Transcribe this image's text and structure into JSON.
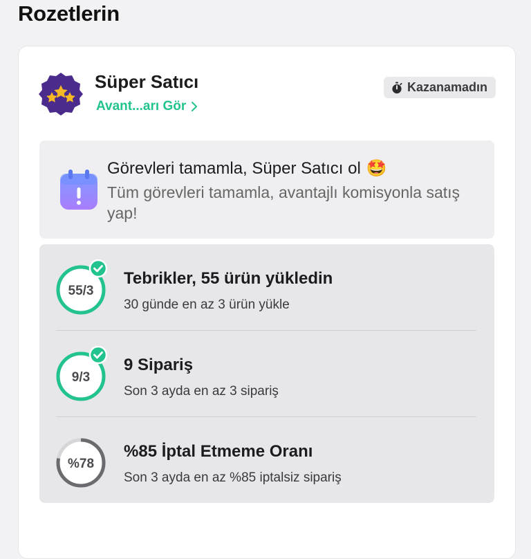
{
  "page_title": "Rozetlerin",
  "badge": {
    "name": "Süper Satıcı",
    "benefits_link": "Avant...arı Gör",
    "status": "Kazanamadın",
    "icon": "stars-badge-icon"
  },
  "info": {
    "title": "Görevleri tamamla, Süper Satıcı ol",
    "emoji": "🤩",
    "description": "Tüm görevleri tamamla, avantajlı komisyonla satış yap!",
    "icon": "calendar-alert-icon"
  },
  "tasks": [
    {
      "ring_label": "55/3",
      "progress": 1.0,
      "completed": true,
      "title": "Tebrikler, 55 ürün yükledin",
      "subtitle": "30 günde en az 3 ürün yükle"
    },
    {
      "ring_label": "9/3",
      "progress": 1.0,
      "completed": true,
      "title": "9 Sipariş",
      "subtitle": "Son 3 ayda en az 3 sipariş"
    },
    {
      "ring_label": "%78",
      "progress": 0.78,
      "completed": false,
      "title": "%85 İptal Etmeme Oranı",
      "subtitle": "Son 3 ayda en az %85 iptalsiz sipariş"
    }
  ],
  "colors": {
    "accent_green": "#22c38e",
    "ring_gray": "#6b6b6f",
    "badge_purple": "#4b2b8c",
    "star_gold": "#f5b825"
  }
}
